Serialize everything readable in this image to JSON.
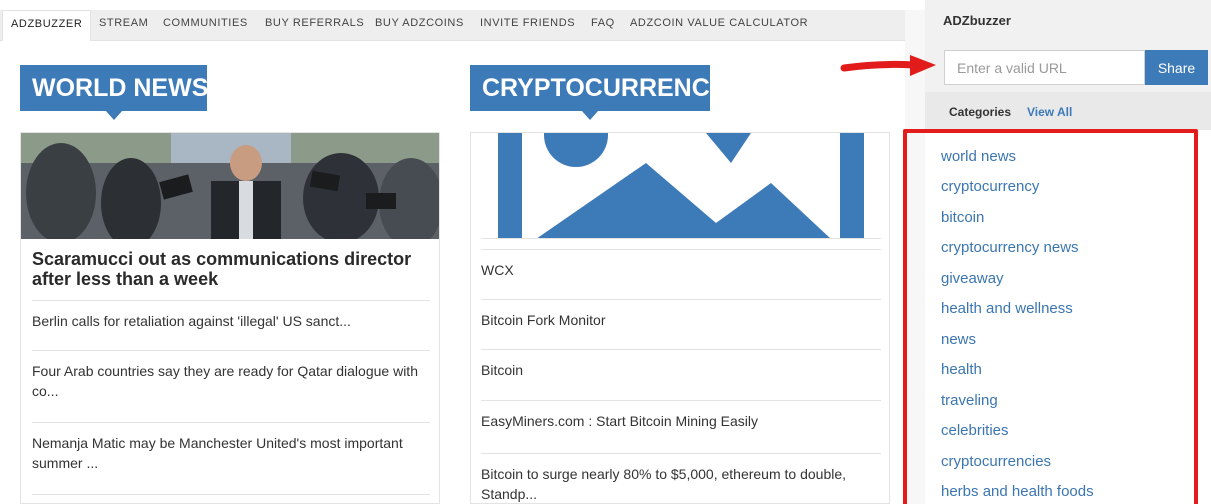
{
  "nav": {
    "items": [
      "ADZBUZZER",
      "STREAM",
      "COMMUNITIES",
      "BUY REFERRALS",
      "BUY ADZCOINS",
      "INVITE FRIENDS",
      "FAQ",
      "ADZCOIN VALUE CALCULATOR"
    ]
  },
  "world_news": {
    "title": "WORLD NEWS",
    "lead": "Scaramucci out as communications director after less than a week",
    "articles": [
      "Berlin calls for retaliation against 'illegal' US sanct...",
      "Four Arab countries say they are ready for Qatar dialogue with co...",
      "Nemanja Matic may be Manchester United's most important summer ..."
    ]
  },
  "crypto": {
    "title": "CRYPTOCURRENCY",
    "articles": [
      "WCX",
      "Bitcoin Fork Monitor",
      "Bitcoin",
      "EasyMiners.com : Start Bitcoin Mining Easily",
      "Bitcoin to surge nearly 80% to $5,000, ethereum to double, Standp..."
    ]
  },
  "sidebar": {
    "title": "ADZbuzzer",
    "url_placeholder": "Enter a valid URL",
    "share_label": "Share",
    "categories_label": "Categories",
    "view_all": "View All",
    "categories": [
      "world news",
      "cryptocurrency",
      "bitcoin",
      "cryptocurrency news",
      "giveaway",
      "health and wellness",
      "news",
      "health",
      "traveling",
      "celebrities",
      "cryptocurrencies",
      "herbs and health foods"
    ]
  },
  "colors": {
    "accent": "#3d7ab8",
    "highlight_red": "#e21b1b"
  }
}
